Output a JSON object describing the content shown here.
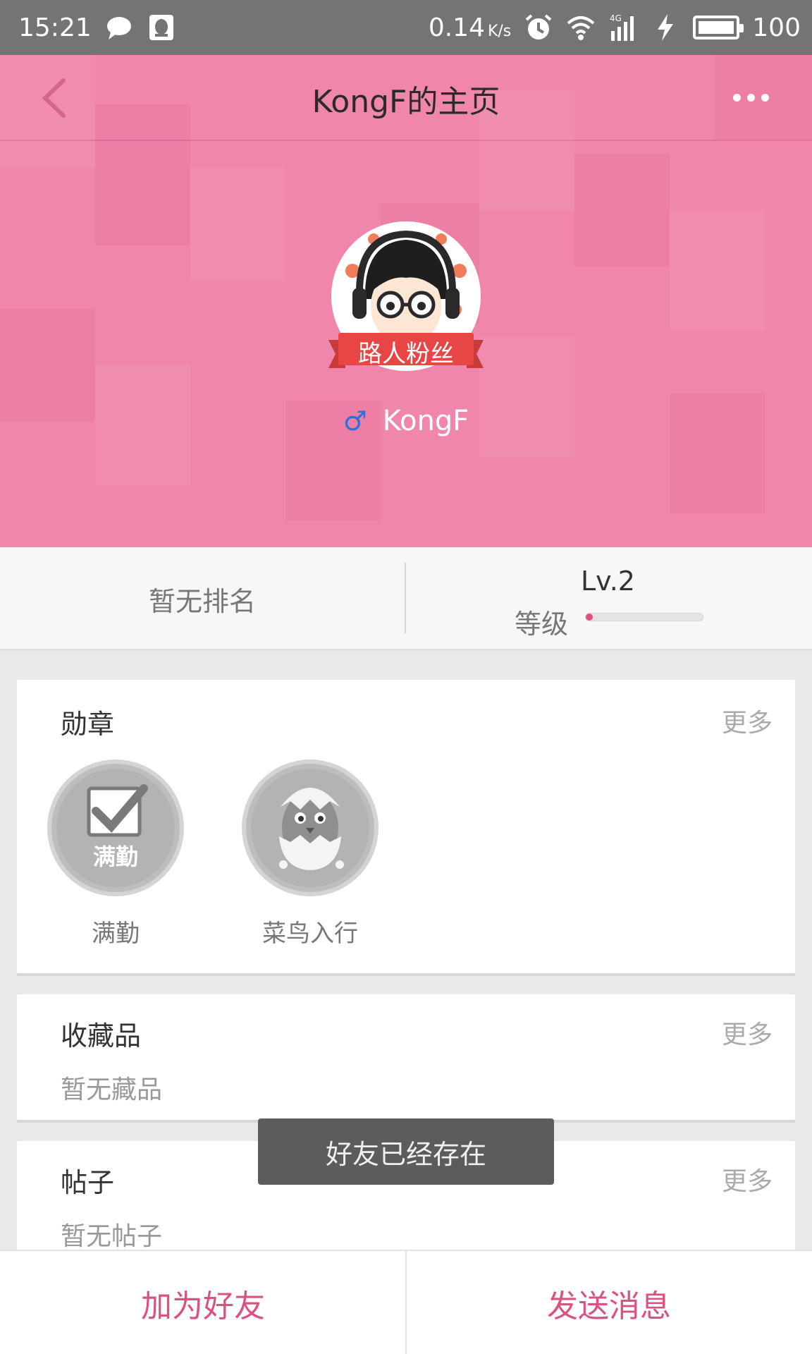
{
  "status_bar": {
    "time": "15:21",
    "net_speed": "0.14",
    "net_unit": "K/s",
    "network": "4G",
    "battery": "100",
    "icons": [
      "chat-bubble-icon",
      "qq-icon",
      "alarm-icon",
      "wifi-icon",
      "signal-icon",
      "charging-icon",
      "battery-icon"
    ]
  },
  "header": {
    "title": "KongF的主页",
    "back_icon": "back-arrow-icon",
    "more_icon": "more-dots-icon"
  },
  "profile": {
    "badge_title": "路人粉丝",
    "gender_icon": "♂",
    "username": "KongF"
  },
  "stats": {
    "rank": "暂无排名",
    "level_value": "Lv.2",
    "level_label": "等级",
    "level_progress": 0.05
  },
  "medals_card": {
    "title": "勋章",
    "more": "更多",
    "items": [
      {
        "label": "满勤",
        "icon": "full-attendance-medal-icon",
        "icon_text": "满勤"
      },
      {
        "label": "菜鸟入行",
        "icon": "hatching-chick-medal-icon"
      }
    ]
  },
  "collections_card": {
    "title": "收藏品",
    "more": "更多",
    "empty": "暂无藏品"
  },
  "posts_card": {
    "title": "帖子",
    "more": "更多",
    "empty": "暂无帖子"
  },
  "toast": "好友已经存在",
  "bottom_bar": {
    "add_friend": "加为好友",
    "send_message": "发送消息"
  },
  "colors": {
    "status_bar": "#747474",
    "hero_pink": "#f086ac",
    "accent": "#d8547f",
    "level_fill": "#e24d84",
    "gender_blue": "#2f6fd8"
  }
}
